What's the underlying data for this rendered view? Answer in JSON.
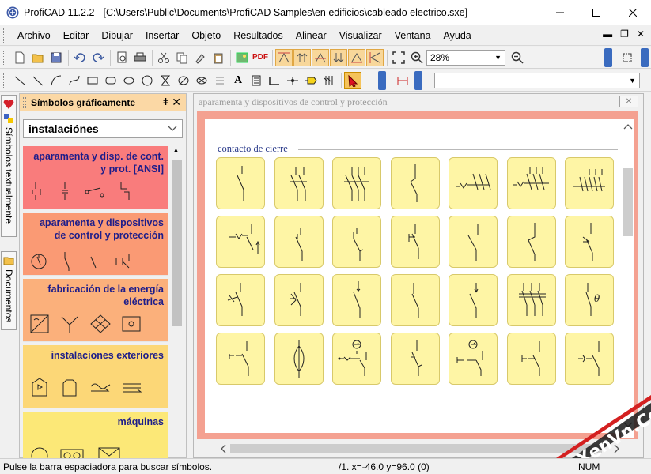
{
  "window": {
    "title": "ProfiCAD 11.2.2 - [C:\\Users\\Public\\Documents\\ProfiCAD Samples\\en edificios\\cableado electrico.sxe]"
  },
  "menu": {
    "items": [
      "Archivo",
      "Editar",
      "Dibujar",
      "Insertar",
      "Objeto",
      "Resultados",
      "Alinear",
      "Visualizar",
      "Ventana",
      "Ayuda"
    ]
  },
  "toolbar": {
    "zoom_value": "28%",
    "pdf_label": "PDF"
  },
  "left_tabs": {
    "textual": "Símbolos textualmente",
    "documents": "Documentos"
  },
  "symbols_panel": {
    "title": "Símbolos gráficamente",
    "pin": "ǂ",
    "close": "✕",
    "library": "instalaciónes",
    "categories": [
      {
        "label": "aparamenta y disp. de cont. y prot. [ANSI]",
        "color": "#f97c7c"
      },
      {
        "label": "aparamenta y dispositivos de control y protección",
        "color": "#fa9a74"
      },
      {
        "label": "fabricación de la energía eléctrica",
        "color": "#fbb07b"
      },
      {
        "label": "instalaciones exteriores",
        "color": "#fcd777"
      },
      {
        "label": "máquinas",
        "color": "#fce877"
      }
    ]
  },
  "document": {
    "tab_title": "aparamenta y dispositivos de control y protección",
    "close": "✕",
    "group_label": "contacto de cierre",
    "symbol_count": 28
  },
  "statusbar": {
    "message": "Pulse la barra espaciadora para buscar símbolos.",
    "coordinates": "/1. x=-46.0  y=96.0 (0)",
    "num": "NUM"
  },
  "watermark": {
    "text": "XenVn.Com"
  },
  "colors": {
    "sheet_border": "#f4a191",
    "tile_fill": "#fef5a5",
    "panel_header": "#fbd8a5",
    "category_text": "#1d1d8a"
  }
}
